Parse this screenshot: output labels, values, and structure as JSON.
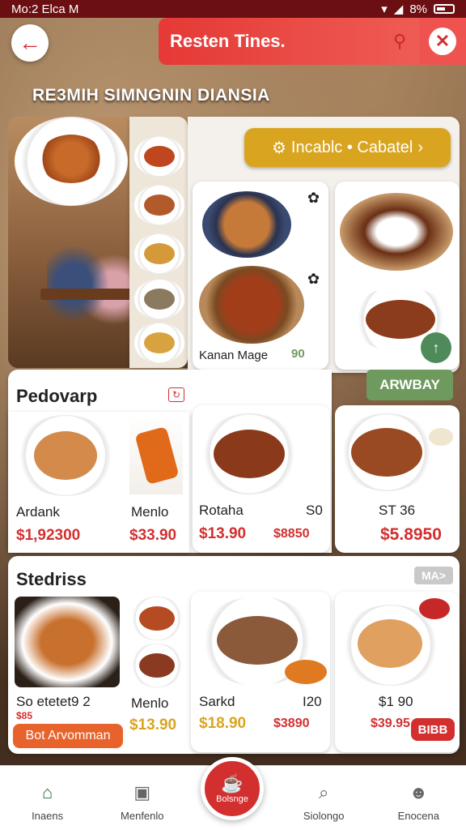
{
  "status": {
    "time": "Mo:2 Elca M",
    "battery": "8%"
  },
  "header": {
    "title": "Resten Tines."
  },
  "hero_title": "RE3MIH SIMNGNIN DIANSIA",
  "promo_button": "Incablc • Cabatel",
  "featured": {
    "name": "Kanan Mage",
    "badge": "90"
  },
  "green_button": "ARWBAY",
  "section1": {
    "title": "Pedovarp",
    "items": [
      {
        "name": "Ardank",
        "price": "$1,92300"
      },
      {
        "name": "Menlo",
        "price": "$33.90"
      },
      {
        "name": "Rotaha",
        "price": "$13.90"
      },
      {
        "name": "S0",
        "price": "$8850"
      },
      {
        "name": "ST 36",
        "price": "$5.8950"
      }
    ]
  },
  "section2": {
    "title": "Stedriss",
    "more_tag": "MA>",
    "items": [
      {
        "name": "So etetet9 2",
        "sub": "$85",
        "price": ""
      },
      {
        "name": "Menlo",
        "price": "$13.90"
      },
      {
        "name": "Sarkd",
        "price": "$18.90"
      },
      {
        "name": "I20",
        "price": "$3890"
      },
      {
        "name": "$1 90",
        "price": "$39.95"
      }
    ],
    "orange_button": "Bot Arvomman",
    "red_badge": "BIBB"
  },
  "nav": {
    "items": [
      {
        "label": "Inaens",
        "icon": "home-icon"
      },
      {
        "label": "Menfenlo",
        "icon": "menu-book-icon"
      },
      {
        "label": "Siolongo",
        "icon": "search-location-icon"
      },
      {
        "label": "Enocena",
        "icon": "people-icon"
      }
    ],
    "fab_label": "Bolsnge"
  },
  "colors": {
    "accent": "#d32f2f",
    "promo": "#d9a520",
    "green": "#6e9a5e",
    "orange": "#e8632b"
  }
}
